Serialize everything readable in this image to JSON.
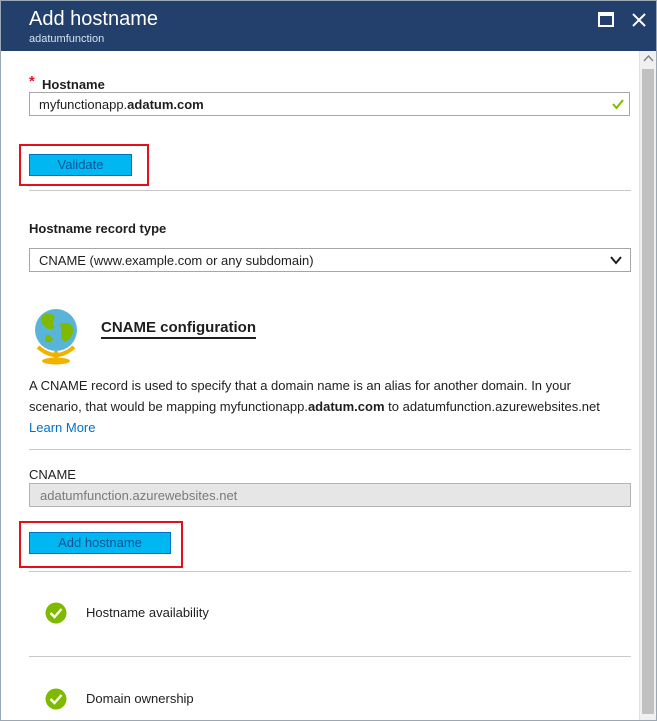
{
  "header": {
    "title": "Add hostname",
    "subtitle": "adatumfunction"
  },
  "hostname": {
    "label": "Hostname",
    "required_marker": "*",
    "value_prefix": "myfunctionapp.",
    "value_domain": "adatum.com",
    "valid": true
  },
  "validate_button": "Validate",
  "record_type": {
    "label": "Hostname record type",
    "selected": "CNAME (www.example.com or any subdomain)"
  },
  "cname_config": {
    "title": "CNAME configuration",
    "desc_part1": "A CNAME record is used to specify that a domain name is an alias for another domain. In your scenario, that would be mapping myfunctionapp.",
    "desc_domain": "adatum.com",
    "desc_part2": " to adatumfunction.azurewebsites.net ",
    "learn_more": "Learn More"
  },
  "cname_field": {
    "label": "CNAME",
    "value": "adatumfunction.azurewebsites.net"
  },
  "add_hostname_button": "Add hostname",
  "checks": [
    {
      "label": "Hostname availability",
      "status": "ok"
    },
    {
      "label": "Domain ownership",
      "status": "ok"
    }
  ],
  "colors": {
    "header_bg": "#22406b",
    "button_bg": "#00b7f1",
    "highlight": "#e3101a",
    "success": "#7fba00",
    "link": "#0072c6"
  },
  "icons": {
    "maximize": "maximize-icon",
    "close": "close-icon",
    "valid": "checkmark-icon",
    "dropdown": "chevron-down-icon",
    "cname": "globe-icon",
    "status": "check-circle-icon"
  }
}
